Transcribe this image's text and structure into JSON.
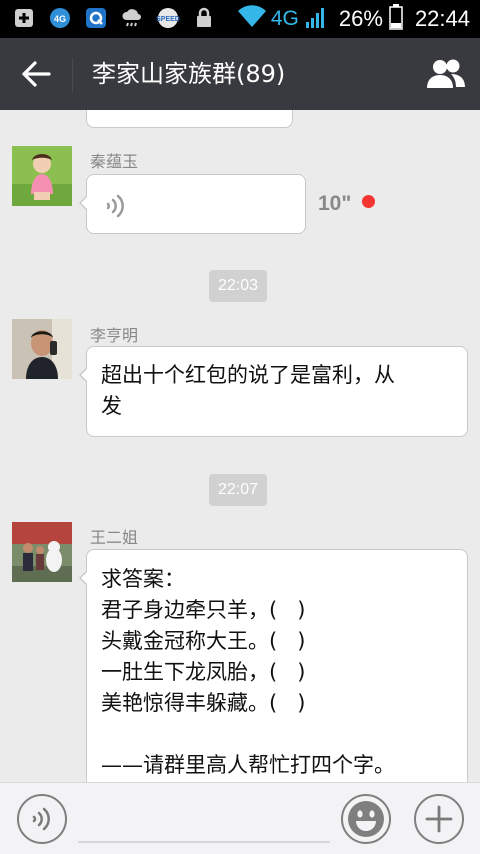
{
  "status_bar": {
    "network": "4G",
    "battery": "26%",
    "time": "22:44",
    "left_icons": [
      "add-box-icon",
      "4g-badge-icon",
      "q-app-icon",
      "cloud-rain-icon",
      "speed-app-icon",
      "lock-icon"
    ]
  },
  "header": {
    "title": "李家山家族群(89)",
    "back_icon": "arrow-left-icon",
    "members_icon": "group-members-icon"
  },
  "messages": [
    {
      "type": "voice",
      "sender": "秦蕴玉",
      "duration": "10\"",
      "unread": true
    },
    {
      "type": "time",
      "time": "22:03"
    },
    {
      "type": "text",
      "sender": "李亨明",
      "text": "超出十个红包的说了是富利，从\n发"
    },
    {
      "type": "time",
      "time": "22:07"
    },
    {
      "type": "text",
      "sender": "王二姐",
      "text": "求答案：\n君子身边牵只羊，(   )\n头戴金冠称大王。(   )\n一肚生下龙凤胎，(   )\n美艳惊得丰躲藏。(   )\n\n——请群里高人帮忙打四个字。"
    }
  ],
  "input_bar": {
    "voice_icon": "voice-input-icon",
    "emoji_icon": "emoji-icon",
    "more_icon": "plus-icon"
  },
  "colors": {
    "titlebar": "#393a3f",
    "chat_bg": "#ebebeb",
    "unread_dot": "#f43530"
  }
}
